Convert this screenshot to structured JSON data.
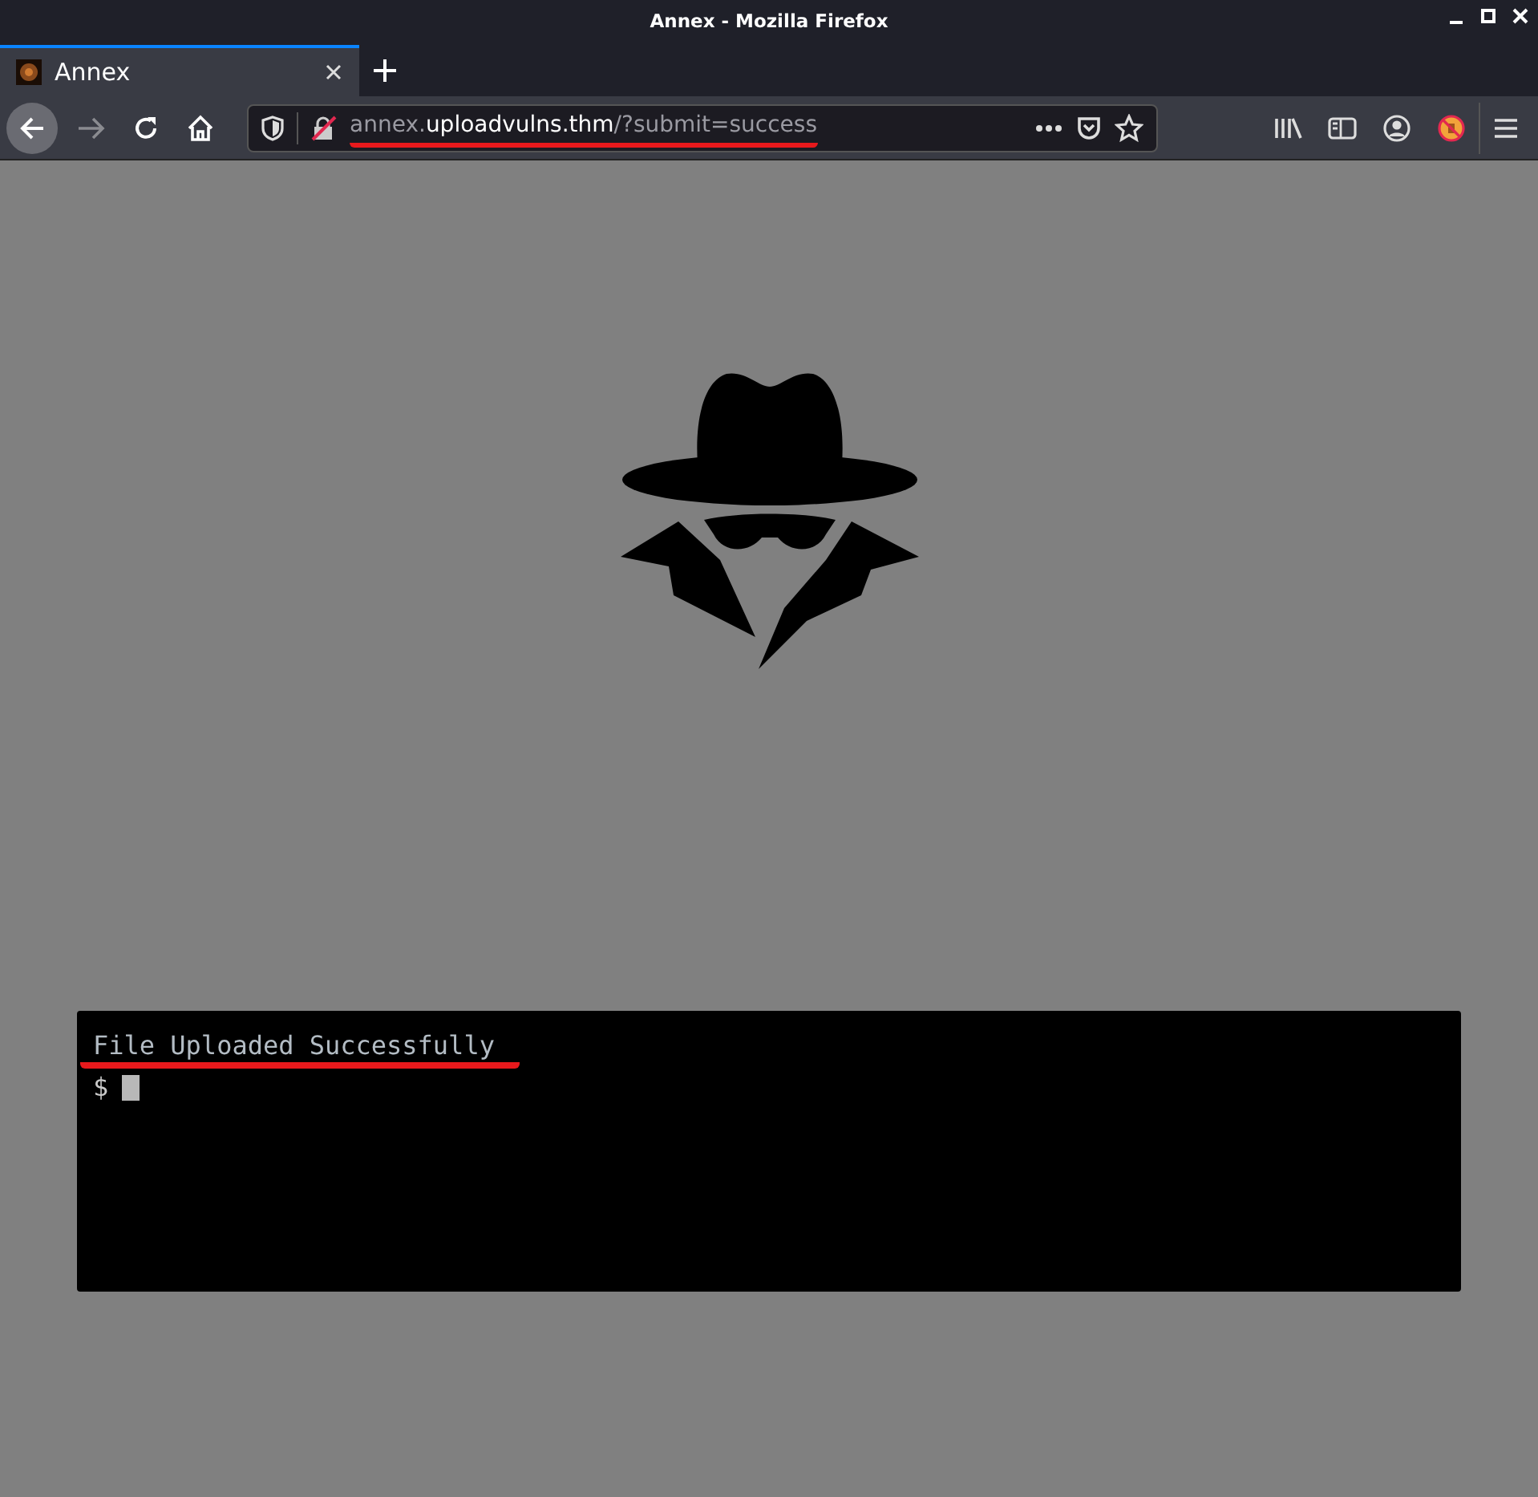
{
  "window": {
    "title": "Annex - Mozilla Firefox"
  },
  "tabs": [
    {
      "label": "Annex",
      "selected": true
    }
  ],
  "address_bar": {
    "url_parts": [
      {
        "text": "annex.",
        "highlighted": false
      },
      {
        "text": "uploadvulns.thm",
        "highlighted": true
      },
      {
        "text": "/?submit=success",
        "highlighted": false
      }
    ],
    "underlined": true,
    "secure": false
  },
  "terminal": {
    "lines": [
      {
        "kind": "output",
        "text": "File Uploaded Successfully",
        "underlined": true
      },
      {
        "kind": "prompt",
        "text": "$",
        "cursor": true
      }
    ]
  }
}
